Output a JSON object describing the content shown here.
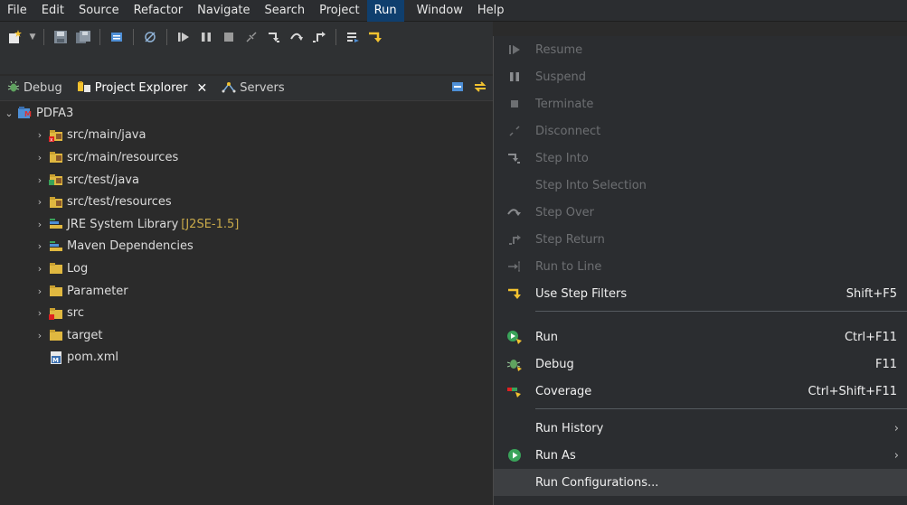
{
  "menubar": {
    "items": [
      "File",
      "Edit",
      "Source",
      "Refactor",
      "Navigate",
      "Search",
      "Project",
      "Run",
      "Window",
      "Help"
    ],
    "active": "Run"
  },
  "toolbar": {
    "icons": [
      "new-wizard-icon",
      "dropdown-arrow-icon",
      "save-icon",
      "save-all-icon",
      "toggle-icon",
      "skip-breakpoints-icon",
      "resume-icon",
      "suspend-icon",
      "terminate-icon",
      "disconnect-icon",
      "step-into-icon",
      "step-over-icon",
      "step-return-icon",
      "drop-to-frame-icon",
      "use-step-filters-icon"
    ]
  },
  "tabs": [
    {
      "label": "Debug",
      "icon": "debug-icon",
      "active": false
    },
    {
      "label": "Project Explorer",
      "icon": "project-explorer-icon",
      "active": true
    },
    {
      "label": "Servers",
      "icon": "servers-icon",
      "active": false
    }
  ],
  "tree": {
    "root": "PDFA3",
    "items": [
      {
        "label": "src/main/java",
        "icon": "source-folder-error-icon",
        "decoration": ""
      },
      {
        "label": "src/main/resources",
        "icon": "source-folder-icon",
        "decoration": ""
      },
      {
        "label": "src/test/java",
        "icon": "test-source-folder-icon",
        "decoration": ""
      },
      {
        "label": "src/test/resources",
        "icon": "source-folder-icon",
        "decoration": ""
      },
      {
        "label": "JRE System Library",
        "icon": "library-icon",
        "decoration": "[J2SE-1.5]"
      },
      {
        "label": "Maven Dependencies",
        "icon": "library-icon",
        "decoration": ""
      },
      {
        "label": "Log",
        "icon": "folder-icon",
        "decoration": ""
      },
      {
        "label": "Parameter",
        "icon": "folder-icon",
        "decoration": ""
      },
      {
        "label": "src",
        "icon": "folder-error-icon",
        "decoration": ""
      },
      {
        "label": "target",
        "icon": "folder-icon",
        "decoration": ""
      },
      {
        "label": "pom.xml",
        "icon": "maven-file-icon",
        "decoration": ""
      }
    ]
  },
  "run_menu": {
    "items": [
      {
        "label": "Resume",
        "accel": "",
        "enabled": false,
        "icon": "resume-icon"
      },
      {
        "label": "Suspend",
        "accel": "",
        "enabled": false,
        "icon": "suspend-icon"
      },
      {
        "label": "Terminate",
        "accel": "",
        "enabled": false,
        "icon": "terminate-icon"
      },
      {
        "label": "Disconnect",
        "accel": "",
        "enabled": false,
        "icon": "disconnect-icon"
      },
      {
        "label": "Step Into",
        "accel": "",
        "enabled": false,
        "icon": "step-into-icon"
      },
      {
        "label": "Step Into Selection",
        "accel": "",
        "enabled": false,
        "icon": ""
      },
      {
        "label": "Step Over",
        "accel": "",
        "enabled": false,
        "icon": "step-over-icon"
      },
      {
        "label": "Step Return",
        "accel": "",
        "enabled": false,
        "icon": "step-return-icon"
      },
      {
        "label": "Run to Line",
        "accel": "",
        "enabled": false,
        "icon": "run-to-line-icon"
      },
      {
        "label": "Use Step Filters",
        "accel": "Shift+F5",
        "enabled": true,
        "icon": "step-filters-icon"
      },
      {
        "label": "Run",
        "accel": "Ctrl+F11",
        "enabled": true,
        "icon": "run-icon"
      },
      {
        "label": "Debug",
        "accel": "F11",
        "enabled": true,
        "icon": "debug-icon"
      },
      {
        "label": "Coverage",
        "accel": "Ctrl+Shift+F11",
        "enabled": true,
        "icon": "coverage-icon"
      },
      {
        "label": "Run History",
        "accel": "",
        "enabled": true,
        "icon": "",
        "submenu": true
      },
      {
        "label": "Run As",
        "accel": "",
        "enabled": true,
        "icon": "run-as-icon",
        "submenu": true
      },
      {
        "label": "Run Configurations...",
        "accel": "",
        "enabled": true,
        "icon": "",
        "hover": true
      }
    ]
  }
}
